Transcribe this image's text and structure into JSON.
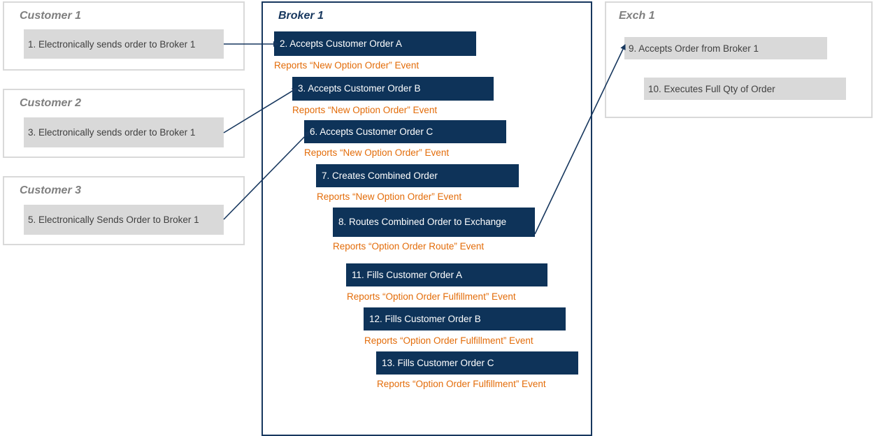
{
  "customer1": {
    "title": "Customer 1",
    "step": "1. Electronically sends order to Broker 1"
  },
  "customer2": {
    "title": "Customer 2",
    "step": "3. Electronically sends order to Broker 1"
  },
  "customer3": {
    "title": "Customer 3",
    "step": "5. Electronically Sends Order to Broker 1"
  },
  "broker": {
    "title": "Broker 1",
    "steps": [
      {
        "label": "2. Accepts Customer Order A",
        "report": "Reports “New Option Order” Event"
      },
      {
        "label": "3. Accepts Customer Order B",
        "report": "Reports “New Option Order” Event"
      },
      {
        "label": "6. Accepts Customer Order C",
        "report": "Reports “New Option Order” Event"
      },
      {
        "label": "7. Creates Combined Order",
        "report": "Reports “New Option Order” Event"
      },
      {
        "label": "8. Routes Combined Order to Exchange",
        "report": "Reports “Option Order Route” Event"
      },
      {
        "label": "11. Fills Customer Order A",
        "report": "Reports “Option Order Fulfillment” Event"
      },
      {
        "label": "12. Fills Customer Order B",
        "report": "Reports “Option Order Fulfillment” Event"
      },
      {
        "label": "13. Fills Customer Order C",
        "report": "Reports “Option Order Fulfillment” Event"
      }
    ]
  },
  "exchange": {
    "title": "Exch 1",
    "steps": [
      "9. Accepts Order from Broker 1",
      "10. Executes Full Qty of Order"
    ]
  },
  "colors": {
    "navy": "#0e3359",
    "orange": "#e36c09",
    "gray_box": "#d9d9d9",
    "gray_text": "#7f7f7f"
  }
}
